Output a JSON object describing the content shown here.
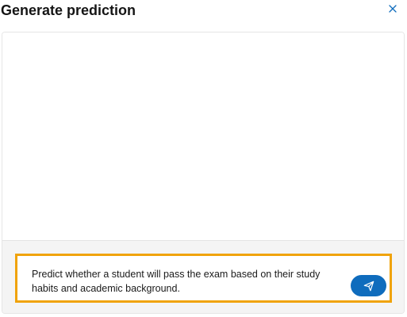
{
  "dialog": {
    "title": "Generate prediction",
    "close_icon": "close-icon"
  },
  "prompt": {
    "value": "Predict whether a student will pass the exam based on their study habits and academic background.",
    "send_icon": "send-icon"
  },
  "colors": {
    "accent": "#0f6cbd",
    "highlight_border": "#f0a30a",
    "close_icon": "#0f6cbd"
  }
}
